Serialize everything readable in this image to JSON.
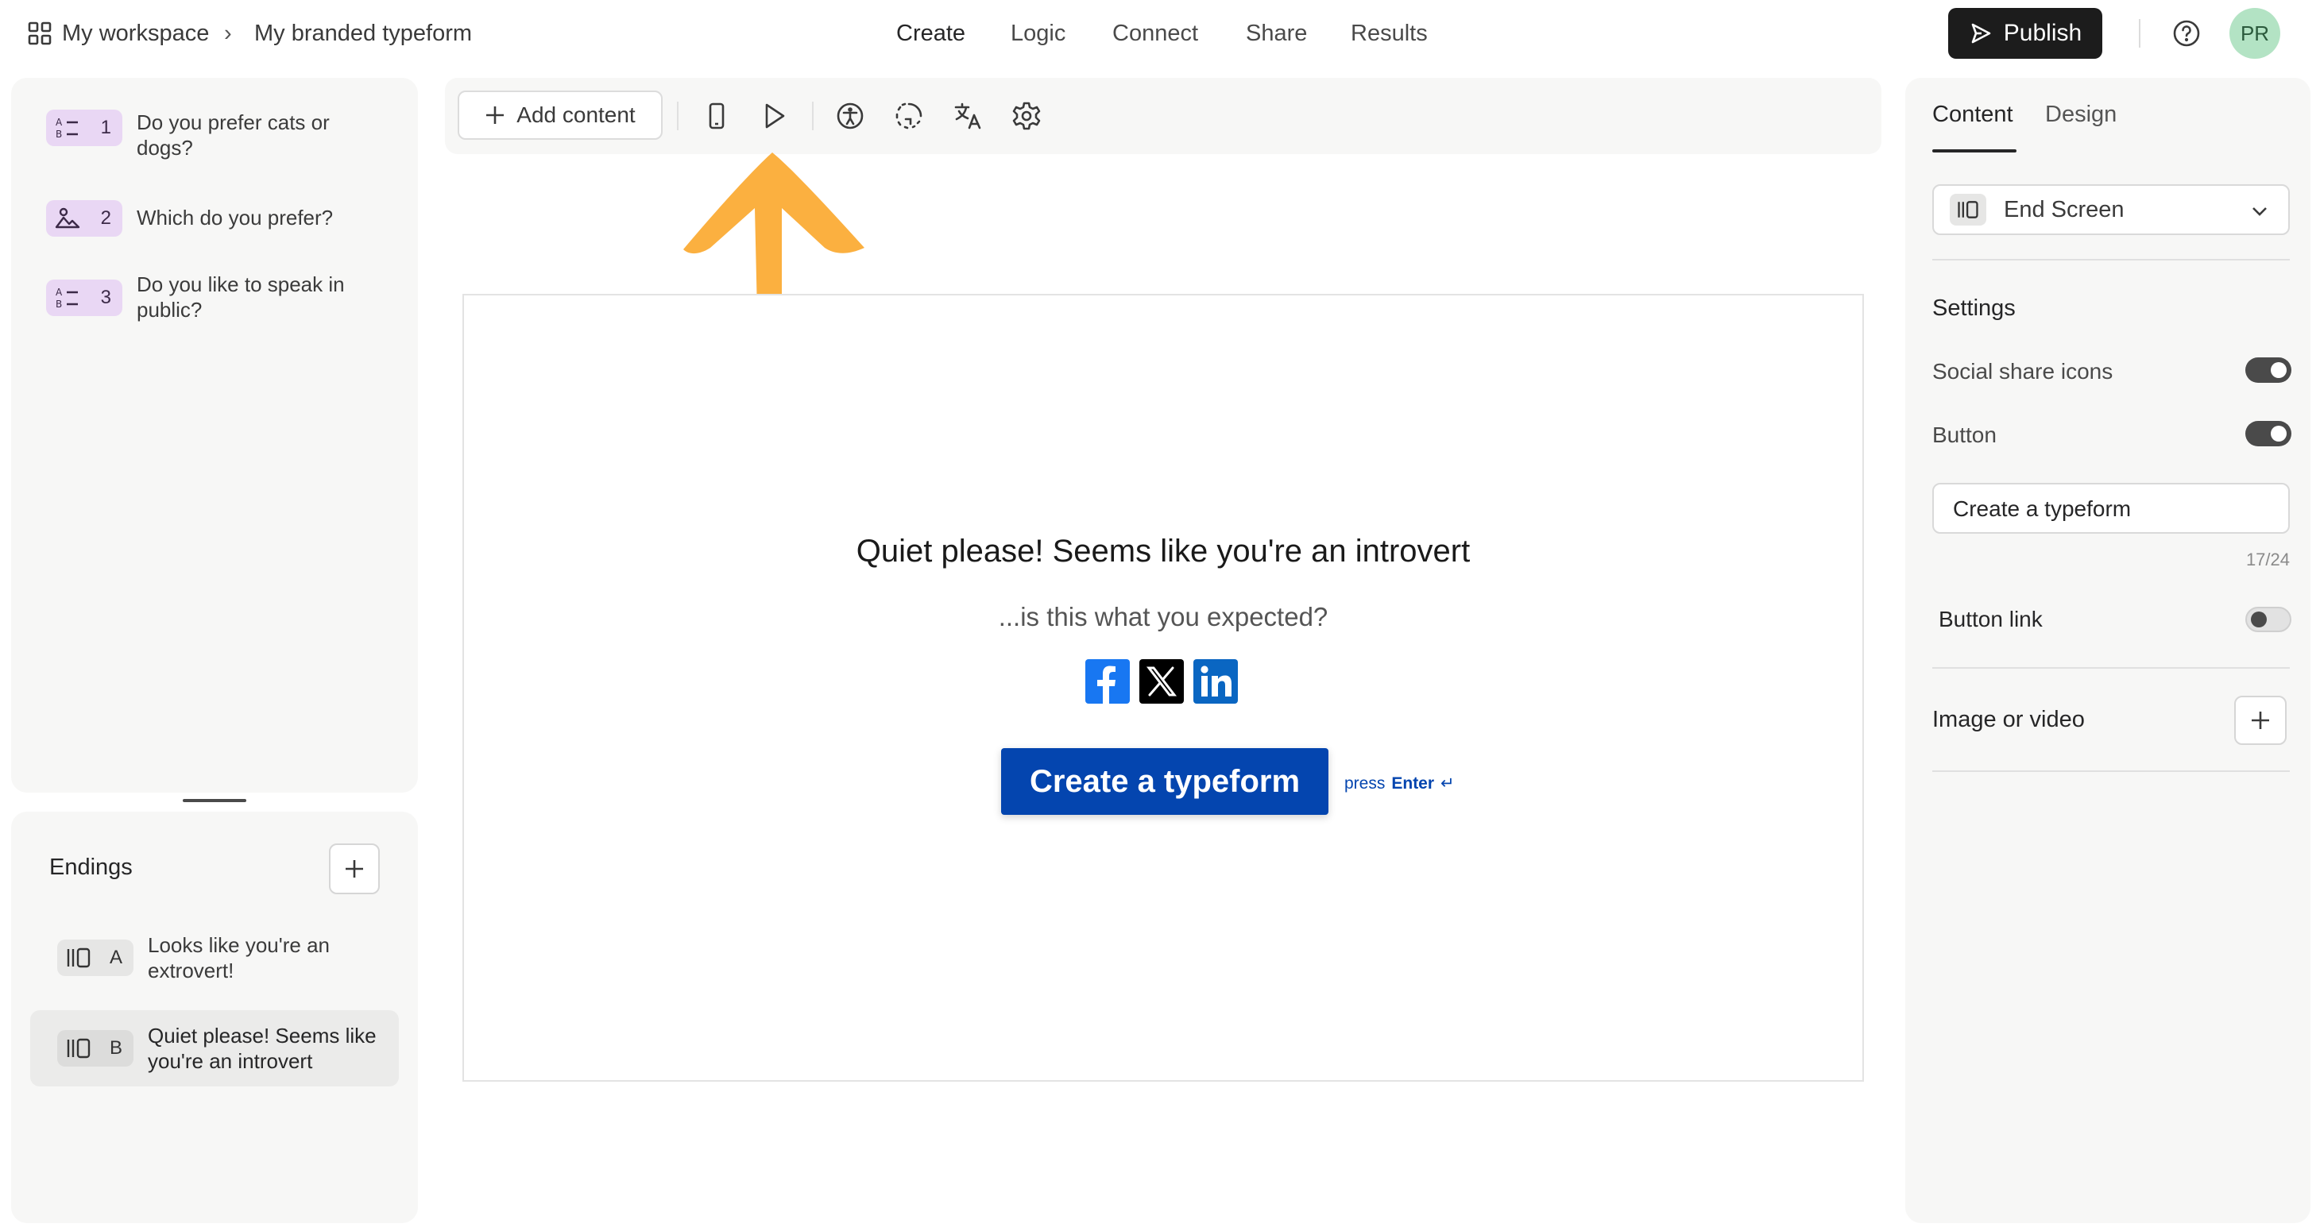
{
  "breadcrumb": {
    "workspace": "My workspace",
    "separator": "›",
    "form_name": "My branded typeform"
  },
  "nav": {
    "tabs": [
      "Create",
      "Logic",
      "Connect",
      "Share",
      "Results"
    ],
    "active": "Create"
  },
  "header": {
    "publish_label": "Publish",
    "help_icon": "help-circle-icon",
    "avatar_initials": "PR"
  },
  "questions": [
    {
      "number": "1",
      "icon": "multiple-choice-icon",
      "text": "Do you prefer cats or dogs?"
    },
    {
      "number": "2",
      "icon": "picture-choice-icon",
      "text": "Which do you prefer?"
    },
    {
      "number": "3",
      "icon": "multiple-choice-icon",
      "text": "Do you like to speak in public?"
    }
  ],
  "endings": {
    "title": "Endings",
    "items": [
      {
        "letter": "A",
        "text": "Looks like you're an extrovert!",
        "selected": false
      },
      {
        "letter": "B",
        "text": "Quiet please! Seems like you're an introvert",
        "selected": true
      }
    ]
  },
  "toolbar": {
    "add_content_label": "Add content",
    "icons": [
      "mobile-preview-icon",
      "play-icon",
      "accessibility-icon",
      "loading-icon",
      "translate-icon",
      "settings-icon"
    ]
  },
  "canvas": {
    "heading": "Quiet please! Seems like you're an introvert",
    "subheading": "...is this what you expected?",
    "social_icons": [
      "facebook-icon",
      "x-icon",
      "linkedin-icon"
    ],
    "button_label": "Create a typeform",
    "press_label": "press",
    "enter_label": "Enter",
    "enter_symbol": "↵"
  },
  "annotation": {
    "arrow_color": "#FBB040"
  },
  "right_panel": {
    "tabs": [
      "Content",
      "Design"
    ],
    "active_tab": "Content",
    "type_select_value": "End Screen",
    "settings_heading": "Settings",
    "social_share_label": "Social share icons",
    "social_share_on": true,
    "button_label": "Button",
    "button_on": true,
    "button_text_value": "Create a typeform",
    "char_count": "17/24",
    "button_link_label": "Button link",
    "button_link_on": false,
    "image_or_video_label": "Image or video"
  },
  "colors": {
    "brand_button": "#0445AF",
    "publish_bg": "#1C1C1C",
    "avatar_bg": "#B3E3C4",
    "question_badge": "#E9D7F4"
  }
}
